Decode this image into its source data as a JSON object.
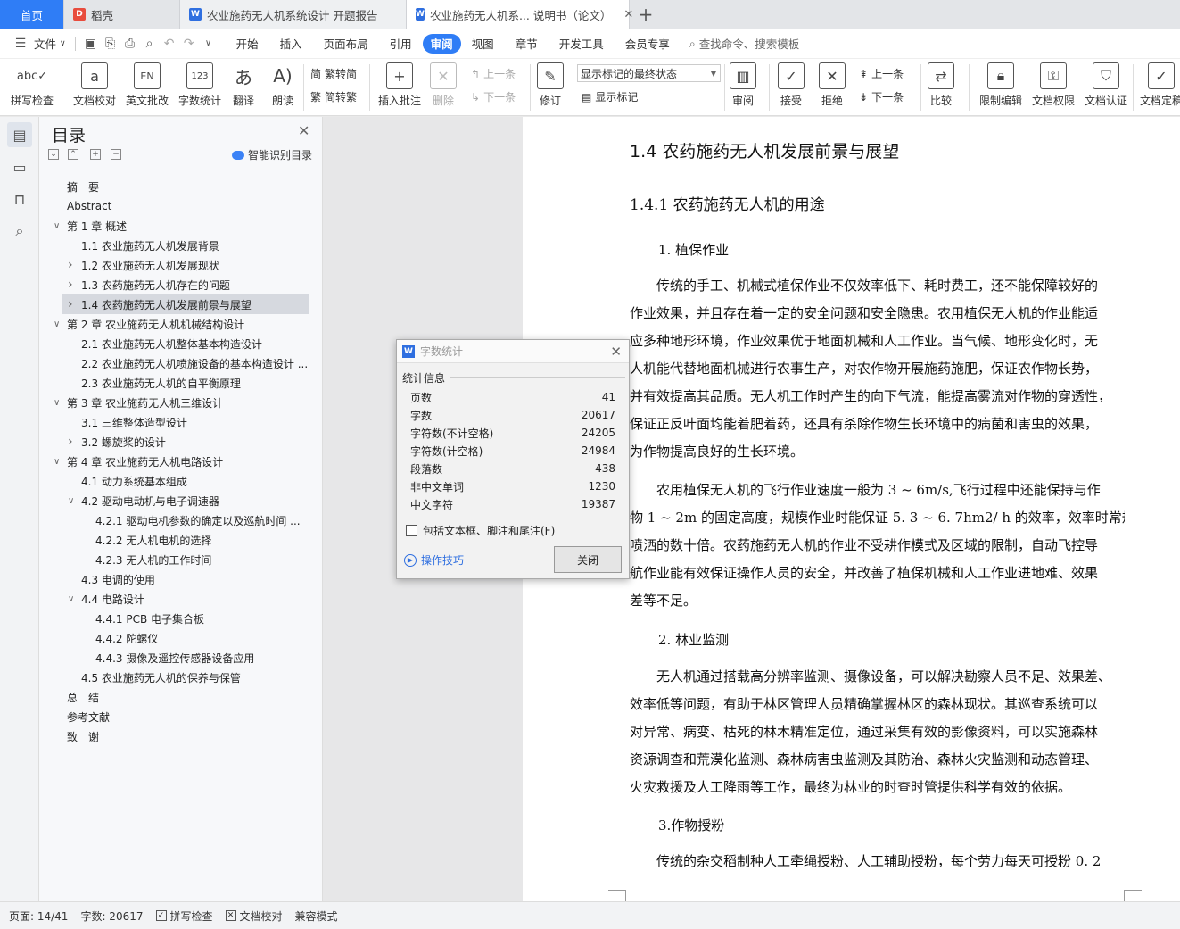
{
  "tabs": [
    {
      "label": "首页"
    },
    {
      "label": "稻壳"
    },
    {
      "label": "农业施药无人机系统设计 开题报告"
    },
    {
      "label": "农业施药无人机系... 说明书（论文）"
    }
  ],
  "menu": {
    "file": "文件",
    "items": [
      "开始",
      "插入",
      "页面布局",
      "引用",
      "审阅",
      "视图",
      "章节",
      "开发工具",
      "会员专享"
    ],
    "search": "查找命令、搜索模板"
  },
  "ribbon": {
    "spell": "拼写检查",
    "proof": "文档校对",
    "english": "英文批改",
    "wordcount": "字数统计",
    "translate": "翻译",
    "read": "朗读",
    "trad": "繁转简",
    "simp": "简转繁",
    "insert_comment": "插入批注",
    "delete": "删除",
    "prev_comment": "上一条",
    "next_comment": "下一条",
    "revise": "修订",
    "show_state": "显示标记的最终状态",
    "show_marks": "显示标记",
    "review": "审阅",
    "accept": "接受",
    "reject": "拒绝",
    "prev": "上一条",
    "next": "下一条",
    "compare": "比较",
    "restrict": "限制编辑",
    "permission": "文档权限",
    "certify": "文档认证",
    "finalize": "文档定稿"
  },
  "toc": {
    "title": "目录",
    "ai_label": "智能识别目录",
    "items": [
      {
        "text": "摘　要"
      },
      {
        "text": "Abstract"
      },
      {
        "text": "第 1 章  概述"
      },
      {
        "text": "1.1 农业施药无人机发展背景"
      },
      {
        "text": "1.2 农业施药无人机发展现状"
      },
      {
        "text": "1.3 农药施药无人机存在的问题"
      },
      {
        "text": "1.4 农药施药无人机发展前景与展望"
      },
      {
        "text": "第 2 章  农业施药无人机机械结构设计"
      },
      {
        "text": "2.1 农业施药无人机整体基本构造设计"
      },
      {
        "text": "2.2 农业施药无人机喷施设备的基本构造设计 ..."
      },
      {
        "text": "2.3 农业施药无人机的自平衡原理"
      },
      {
        "text": "第 3 章  农业施药无人机三维设计"
      },
      {
        "text": "3.1 三维整体造型设计"
      },
      {
        "text": "3.2 螺旋桨的设计"
      },
      {
        "text": "第 4 章  农业施药无人机电路设计"
      },
      {
        "text": "4.1 动力系统基本组成"
      },
      {
        "text": "4.2 驱动电动机与电子调速器"
      },
      {
        "text": "4.2.1 驱动电机参数的确定以及巡航时间 ..."
      },
      {
        "text": "4.2.2 无人机电机的选择"
      },
      {
        "text": "4.2.3 无人机的工作时间"
      },
      {
        "text": "4.3 电调的使用"
      },
      {
        "text": "4.4 电路设计"
      },
      {
        "text": "4.4.1 PCB 电子集合板"
      },
      {
        "text": "4.4.2 陀螺仪"
      },
      {
        "text": "4.4.3 摄像及遥控传感器设备应用"
      },
      {
        "text": "4.5 农业施药无人机的保养与保管"
      },
      {
        "text": "总　结"
      },
      {
        "text": "参考文献"
      },
      {
        "text": "致　谢"
      }
    ]
  },
  "doc": {
    "h1": "1.4 农药施药无人机发展前景与展望",
    "h2": "1.4.1 农药施药无人机的用途",
    "s1": "1.  植保作业",
    "p1": [
      "　　传统的手工、机械式植保作业不仅效率低下、耗时费工，还不能保障较好的",
      "作业效果，并且存在着一定的安全问题和安全隐患。农用植保无人机的作业能适",
      "应多种地形环境，作业效果优于地面机械和人工作业。当气候、地形变化时，无",
      "人机能代替地面机械进行农事生产，对农作物开展施药施肥，保证农作物长势，",
      "并有效提高其品质。无人机工作时产生的向下气流，能提高雾流对作物的穿透性，",
      "保证正反叶面均能着肥着药，还具有杀除作物生长环境中的病菌和害虫的效果，",
      "为作物提高良好的生长环境。"
    ],
    "p2": [
      "　　农用植保无人机的飞行作业速度一般为 3 ~ 6m/s,飞行过程中还能保持与作",
      "物 1 ~ 2m 的固定高度，规模作业时能保证 5. 3 ~ 6. 7hm2/ h 的效率，效率时常规",
      "喷洒的数十倍。农药施药无人机的作业不受耕作模式及区域的限制，自动飞控导",
      "航作业能有效保证操作人员的安全，并改善了植保机械和人工作业进地难、效果",
      "差等不足。"
    ],
    "s2": "2.  林业监测",
    "p3": [
      "　　无人机通过搭载高分辨率监测、摄像设备，可以解决勘察人员不足、效果差、",
      "效率低等问题，有助于林区管理人员精确掌握林区的森林现状。其巡查系统可以",
      "对异常、病变、枯死的林木精准定位，通过采集有效的影像资料，可以实施森林",
      "资源调查和荒漠化监测、森林病害虫监测及其防治、森林火灾监测和动态管理、",
      "火灾救援及人工降雨等工作，最终为林业的时查时管提供科学有效的依据。"
    ],
    "s3": "3.作物授粉",
    "p4": [
      "　　传统的杂交稻制种人工牵绳授粉、人工辅助授粉，每个劳力每天可授粉 0. 2"
    ]
  },
  "dialog": {
    "title": "字数统计",
    "group": "统计信息",
    "rows": [
      {
        "label": "页数",
        "value": "41"
      },
      {
        "label": "字数",
        "value": "20617"
      },
      {
        "label": "字符数(不计空格)",
        "value": "24205"
      },
      {
        "label": "字符数(计空格)",
        "value": "24984"
      },
      {
        "label": "段落数",
        "value": "438"
      },
      {
        "label": "非中文单词",
        "value": "1230"
      },
      {
        "label": "中文字符",
        "value": "19387"
      }
    ],
    "checkbox": "包括文本框、脚注和尾注(F)",
    "tips": "操作技巧",
    "close": "关闭"
  },
  "status": {
    "page": "页面: 14/41",
    "words": "字数: 20617",
    "spell": "拼写检查",
    "proof": "文档校对",
    "compat": "兼容模式"
  },
  "colors": {
    "accent": "#2f7df6"
  }
}
